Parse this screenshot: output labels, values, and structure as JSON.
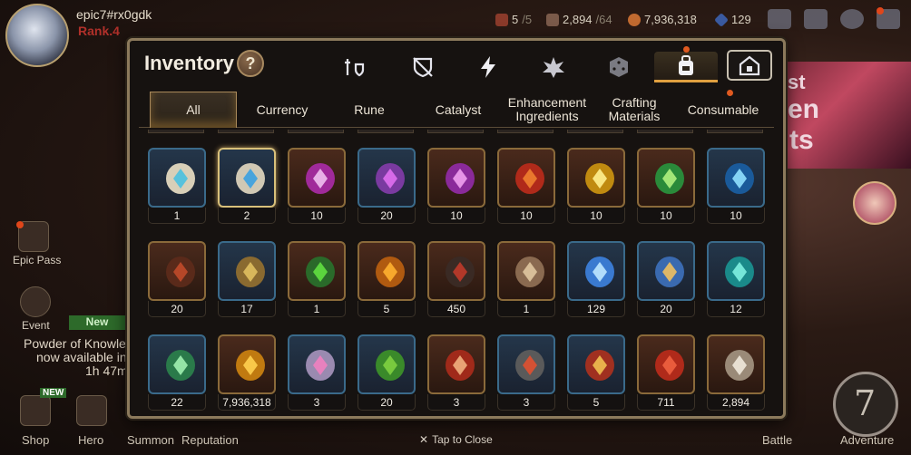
{
  "player": {
    "name": "epic7#rx0gdk",
    "rank": "Rank.4"
  },
  "resources": {
    "stamina": {
      "value": "5",
      "max": "/5"
    },
    "energy": {
      "value": "2,894",
      "max": "/64"
    },
    "gold": "7,936,318",
    "crystals": "129"
  },
  "hud": {
    "epic_pass": "Epic Pass",
    "event": "Event",
    "new_badge": "New",
    "powder_line1": "Powder of Knowle",
    "powder_line2": "now available in",
    "powder_line3": "1h 47m",
    "shop": "Shop",
    "hero": "Hero",
    "summon": "Summon",
    "reputation": "Reputation",
    "battle": "Battle",
    "adventure": "Adventure",
    "new_label": "NEW",
    "banner_text_1": "st",
    "banner_text_2": "en",
    "banner_text_3": "ts",
    "adventure_numeral": "7"
  },
  "inventory": {
    "title": "Inventory",
    "help": "?",
    "category_icons": [
      "equipment-icon",
      "artifact-icon",
      "lightning-icon",
      "spirit-icon",
      "dice-icon",
      "backpack-icon",
      "house-icon"
    ],
    "sub_tabs": [
      {
        "label": "All"
      },
      {
        "label": "Currency"
      },
      {
        "label": "Rune"
      },
      {
        "label": "Catalyst"
      },
      {
        "label": "Enhancement Ingredients"
      },
      {
        "label": "Crafting Materials"
      },
      {
        "label": "Consumable"
      }
    ],
    "items": [
      {
        "qty": "1",
        "icon": "cyan-rune-stone"
      },
      {
        "qty": "2",
        "icon": "blue-rune-stone"
      },
      {
        "qty": "10",
        "icon": "purple-crystal"
      },
      {
        "qty": "20",
        "icon": "purple-triangle-rune"
      },
      {
        "qty": "10",
        "icon": "purple-orb"
      },
      {
        "qty": "10",
        "icon": "red-orb"
      },
      {
        "qty": "10",
        "icon": "yellow-orb"
      },
      {
        "qty": "10",
        "icon": "green-orb"
      },
      {
        "qty": "10",
        "icon": "blue-orb"
      },
      {
        "qty": "20",
        "icon": "claw"
      },
      {
        "qty": "17",
        "icon": "ring"
      },
      {
        "qty": "1",
        "icon": "green-orb-frame"
      },
      {
        "qty": "5",
        "icon": "fire-crystal"
      },
      {
        "qty": "450",
        "icon": "dark-ring"
      },
      {
        "qty": "1",
        "icon": "dagger"
      },
      {
        "qty": "129",
        "icon": "blue-gem"
      },
      {
        "qty": "20",
        "icon": "star-pendant"
      },
      {
        "qty": "12",
        "icon": "teal-crystal"
      },
      {
        "qty": "22",
        "icon": "leaf"
      },
      {
        "qty": "7,936,318",
        "icon": "gold-coin"
      },
      {
        "qty": "3",
        "icon": "pink-gadget"
      },
      {
        "qty": "20",
        "icon": "green-heart"
      },
      {
        "qty": "3",
        "icon": "red-badge"
      },
      {
        "qty": "3",
        "icon": "stone-cube"
      },
      {
        "qty": "5",
        "icon": "banner"
      },
      {
        "qty": "711",
        "icon": "broken-heart"
      },
      {
        "qty": "2,894",
        "icon": "chess-knight"
      }
    ],
    "close_hint": "Tap to Close"
  },
  "colors": {
    "accent": "#e0a040",
    "panel_border": "#8c7a5c",
    "red_dot": "#e0461a"
  }
}
